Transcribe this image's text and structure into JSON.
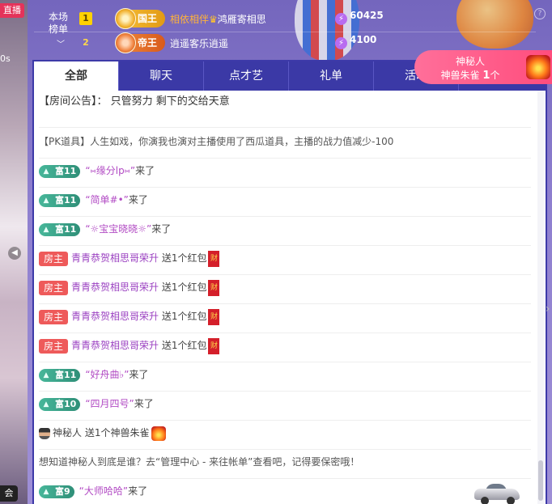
{
  "stream": {
    "live_label": "直播",
    "side_text": "0s",
    "bottom_label": "会"
  },
  "ranking": {
    "title": "本场\n榜单",
    "rows": [
      {
        "rank": "1",
        "badge": "国王",
        "name_left": "相依相伴",
        "name_right": "鸿雁寄相思",
        "score": "60425"
      },
      {
        "rank": "2",
        "badge": "帝王",
        "name": "逍遥客乐逍遥",
        "score": "4100"
      }
    ]
  },
  "mystery": {
    "line1": "神秘人",
    "line2_prefix": "神兽朱雀",
    "line2_count": "1",
    "line2_suffix": "个"
  },
  "tabs": [
    "全部",
    "聊天",
    "点才艺",
    "礼单",
    "活动"
  ],
  "announcement": "【房间公告】：  只管努力 剩下的交给天意",
  "messages": [
    {
      "type": "pk",
      "text": "【PK道具】人生如戏，你演我也演对主播使用了西瓜道具，主播的战力值减少-100"
    },
    {
      "type": "enter",
      "level": "富11",
      "user": "“⑅缘分lp⑅”",
      "suffix": "来了"
    },
    {
      "type": "enter",
      "level": "富11",
      "user": "“简单#•”",
      "suffix": "来了"
    },
    {
      "type": "enter",
      "level": "富11",
      "user": "“☼宝宝晓晓☼”",
      "suffix": "来了"
    },
    {
      "type": "gift",
      "badge": "房主",
      "user": "青青恭贺相思哥荣升",
      "text": " 送1个红包",
      "icon": "财"
    },
    {
      "type": "gift",
      "badge": "房主",
      "user": "青青恭贺相思哥荣升",
      "text": " 送1个红包",
      "icon": "财"
    },
    {
      "type": "gift",
      "badge": "房主",
      "user": "青青恭贺相思哥荣升",
      "text": " 送1个红包",
      "icon": "财"
    },
    {
      "type": "gift",
      "badge": "房主",
      "user": "青青恭贺相思哥荣升",
      "text": " 送1个红包",
      "icon": "财"
    },
    {
      "type": "enter",
      "level": "富11",
      "user": "“好舟曲♭”",
      "suffix": "来了"
    },
    {
      "type": "enter",
      "level": "富10",
      "user": "“四月四号”",
      "suffix": "来了"
    },
    {
      "type": "mystery",
      "user": "神秘人",
      "text": " 送1个神兽朱雀"
    },
    {
      "type": "hint",
      "text": "想知道神秘人到底是谁？去“管理中心 - 来往帐单”查看吧，记得要保密哦！"
    },
    {
      "type": "enter-car",
      "level": "富9",
      "user": "“大师哈哈”",
      "suffix": "来了"
    }
  ]
}
